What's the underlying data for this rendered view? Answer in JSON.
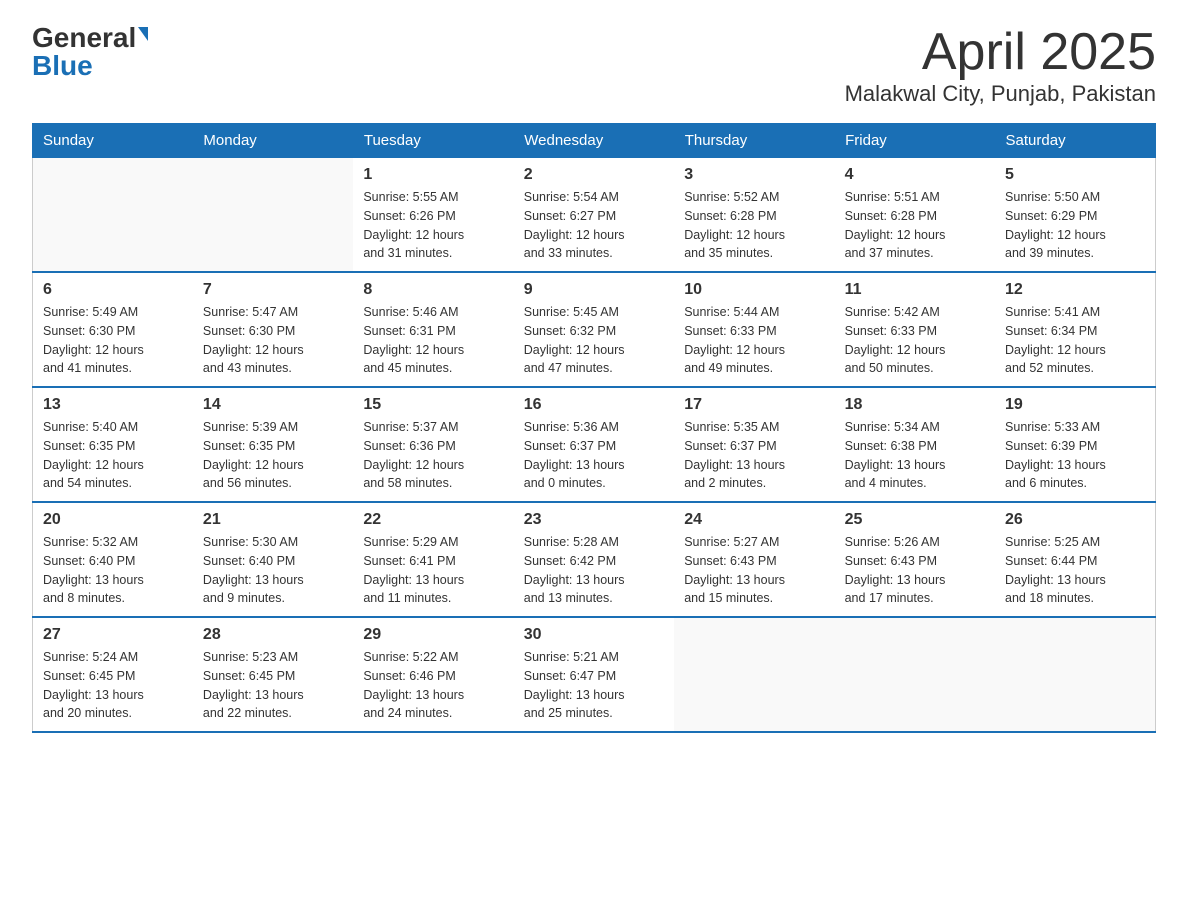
{
  "header": {
    "logo_general": "General",
    "logo_blue": "Blue",
    "title": "April 2025",
    "subtitle": "Malakwal City, Punjab, Pakistan"
  },
  "calendar": {
    "days_of_week": [
      "Sunday",
      "Monday",
      "Tuesday",
      "Wednesday",
      "Thursday",
      "Friday",
      "Saturday"
    ],
    "weeks": [
      [
        {
          "day": "",
          "info": ""
        },
        {
          "day": "",
          "info": ""
        },
        {
          "day": "1",
          "info": "Sunrise: 5:55 AM\nSunset: 6:26 PM\nDaylight: 12 hours\nand 31 minutes."
        },
        {
          "day": "2",
          "info": "Sunrise: 5:54 AM\nSunset: 6:27 PM\nDaylight: 12 hours\nand 33 minutes."
        },
        {
          "day": "3",
          "info": "Sunrise: 5:52 AM\nSunset: 6:28 PM\nDaylight: 12 hours\nand 35 minutes."
        },
        {
          "day": "4",
          "info": "Sunrise: 5:51 AM\nSunset: 6:28 PM\nDaylight: 12 hours\nand 37 minutes."
        },
        {
          "day": "5",
          "info": "Sunrise: 5:50 AM\nSunset: 6:29 PM\nDaylight: 12 hours\nand 39 minutes."
        }
      ],
      [
        {
          "day": "6",
          "info": "Sunrise: 5:49 AM\nSunset: 6:30 PM\nDaylight: 12 hours\nand 41 minutes."
        },
        {
          "day": "7",
          "info": "Sunrise: 5:47 AM\nSunset: 6:30 PM\nDaylight: 12 hours\nand 43 minutes."
        },
        {
          "day": "8",
          "info": "Sunrise: 5:46 AM\nSunset: 6:31 PM\nDaylight: 12 hours\nand 45 minutes."
        },
        {
          "day": "9",
          "info": "Sunrise: 5:45 AM\nSunset: 6:32 PM\nDaylight: 12 hours\nand 47 minutes."
        },
        {
          "day": "10",
          "info": "Sunrise: 5:44 AM\nSunset: 6:33 PM\nDaylight: 12 hours\nand 49 minutes."
        },
        {
          "day": "11",
          "info": "Sunrise: 5:42 AM\nSunset: 6:33 PM\nDaylight: 12 hours\nand 50 minutes."
        },
        {
          "day": "12",
          "info": "Sunrise: 5:41 AM\nSunset: 6:34 PM\nDaylight: 12 hours\nand 52 minutes."
        }
      ],
      [
        {
          "day": "13",
          "info": "Sunrise: 5:40 AM\nSunset: 6:35 PM\nDaylight: 12 hours\nand 54 minutes."
        },
        {
          "day": "14",
          "info": "Sunrise: 5:39 AM\nSunset: 6:35 PM\nDaylight: 12 hours\nand 56 minutes."
        },
        {
          "day": "15",
          "info": "Sunrise: 5:37 AM\nSunset: 6:36 PM\nDaylight: 12 hours\nand 58 minutes."
        },
        {
          "day": "16",
          "info": "Sunrise: 5:36 AM\nSunset: 6:37 PM\nDaylight: 13 hours\nand 0 minutes."
        },
        {
          "day": "17",
          "info": "Sunrise: 5:35 AM\nSunset: 6:37 PM\nDaylight: 13 hours\nand 2 minutes."
        },
        {
          "day": "18",
          "info": "Sunrise: 5:34 AM\nSunset: 6:38 PM\nDaylight: 13 hours\nand 4 minutes."
        },
        {
          "day": "19",
          "info": "Sunrise: 5:33 AM\nSunset: 6:39 PM\nDaylight: 13 hours\nand 6 minutes."
        }
      ],
      [
        {
          "day": "20",
          "info": "Sunrise: 5:32 AM\nSunset: 6:40 PM\nDaylight: 13 hours\nand 8 minutes."
        },
        {
          "day": "21",
          "info": "Sunrise: 5:30 AM\nSunset: 6:40 PM\nDaylight: 13 hours\nand 9 minutes."
        },
        {
          "day": "22",
          "info": "Sunrise: 5:29 AM\nSunset: 6:41 PM\nDaylight: 13 hours\nand 11 minutes."
        },
        {
          "day": "23",
          "info": "Sunrise: 5:28 AM\nSunset: 6:42 PM\nDaylight: 13 hours\nand 13 minutes."
        },
        {
          "day": "24",
          "info": "Sunrise: 5:27 AM\nSunset: 6:43 PM\nDaylight: 13 hours\nand 15 minutes."
        },
        {
          "day": "25",
          "info": "Sunrise: 5:26 AM\nSunset: 6:43 PM\nDaylight: 13 hours\nand 17 minutes."
        },
        {
          "day": "26",
          "info": "Sunrise: 5:25 AM\nSunset: 6:44 PM\nDaylight: 13 hours\nand 18 minutes."
        }
      ],
      [
        {
          "day": "27",
          "info": "Sunrise: 5:24 AM\nSunset: 6:45 PM\nDaylight: 13 hours\nand 20 minutes."
        },
        {
          "day": "28",
          "info": "Sunrise: 5:23 AM\nSunset: 6:45 PM\nDaylight: 13 hours\nand 22 minutes."
        },
        {
          "day": "29",
          "info": "Sunrise: 5:22 AM\nSunset: 6:46 PM\nDaylight: 13 hours\nand 24 minutes."
        },
        {
          "day": "30",
          "info": "Sunrise: 5:21 AM\nSunset: 6:47 PM\nDaylight: 13 hours\nand 25 minutes."
        },
        {
          "day": "",
          "info": ""
        },
        {
          "day": "",
          "info": ""
        },
        {
          "day": "",
          "info": ""
        }
      ]
    ]
  }
}
